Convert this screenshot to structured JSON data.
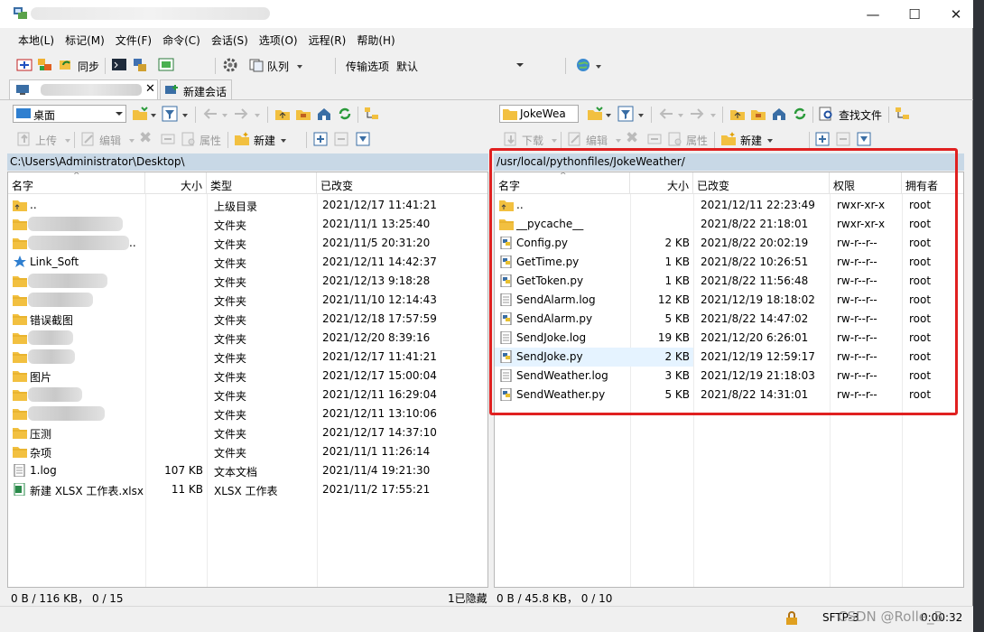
{
  "menu": [
    "本地(L)",
    "标记(M)",
    "文件(F)",
    "命令(C)",
    "会话(S)",
    "选项(O)",
    "远程(R)",
    "帮助(H)"
  ],
  "toolbar1": {
    "sync": "同步",
    "queue": "队列",
    "transfer_label": "传输选项",
    "transfer_value": "默认"
  },
  "tabs": {
    "new_session": "新建会话"
  },
  "left": {
    "location": "桌面",
    "upload": "上传",
    "edit": "编辑",
    "properties": "属性",
    "new": "新建",
    "path": "C:\\Users\\Administrator\\Desktop\\",
    "columns": [
      "名字",
      "大小",
      "类型",
      "已改变"
    ],
    "rows": [
      {
        "name": "..",
        "size": "",
        "type": "上级目录",
        "changed": "2021/12/17  11:41:21",
        "icon": "up"
      },
      {
        "name": "",
        "size": "",
        "type": "文件夹",
        "changed": "2021/11/1  13:25:40",
        "icon": "folder"
      },
      {
        "name": "..",
        "size": "",
        "type": "文件夹",
        "changed": "2021/11/5  20:31:20",
        "icon": "folder"
      },
      {
        "name": "Link_Soft",
        "size": "",
        "type": "文件夹",
        "changed": "2021/12/11  14:42:37",
        "icon": "star"
      },
      {
        "name": "",
        "size": "",
        "type": "文件夹",
        "changed": "2021/12/13  9:18:28",
        "icon": "folder"
      },
      {
        "name": "",
        "size": "",
        "type": "文件夹",
        "changed": "2021/11/10  12:14:43",
        "icon": "folder"
      },
      {
        "name": "错误截图",
        "size": "",
        "type": "文件夹",
        "changed": "2021/12/18  17:57:59",
        "icon": "folder"
      },
      {
        "name": "",
        "size": "",
        "type": "文件夹",
        "changed": "2021/12/20  8:39:16",
        "icon": "folder"
      },
      {
        "name": "",
        "size": "",
        "type": "文件夹",
        "changed": "2021/12/17  11:41:21",
        "icon": "folder"
      },
      {
        "name": "图片",
        "size": "",
        "type": "文件夹",
        "changed": "2021/12/17  15:00:04",
        "icon": "folder"
      },
      {
        "name": "",
        "size": "",
        "type": "文件夹",
        "changed": "2021/12/11  16:29:04",
        "icon": "folder"
      },
      {
        "name": "",
        "size": "",
        "type": "文件夹",
        "changed": "2021/12/11  13:10:06",
        "icon": "folder"
      },
      {
        "name": "压测",
        "size": "",
        "type": "文件夹",
        "changed": "2021/12/17  14:37:10",
        "icon": "folder"
      },
      {
        "name": "杂项",
        "size": "",
        "type": "文件夹",
        "changed": "2021/11/1  11:26:14",
        "icon": "folder"
      },
      {
        "name": "1.log",
        "size": "107 KB",
        "type": "文本文档",
        "changed": "2021/11/4  19:21:30",
        "icon": "doc"
      },
      {
        "name": "新建 XLSX 工作表.xlsx",
        "size": "11 KB",
        "type": "XLSX 工作表",
        "changed": "2021/11/2  17:55:21",
        "icon": "xlsx"
      }
    ],
    "status": "0 B / 116 KB， 0 / 15",
    "hidden": "1已隐藏"
  },
  "right": {
    "location": "JokeWea",
    "download": "下载",
    "edit": "编辑",
    "properties": "属性",
    "new": "新建",
    "find": "查找文件",
    "path": "/usr/local/pythonfiles/JokeWeather/",
    "columns": [
      "名字",
      "大小",
      "已改变",
      "权限",
      "拥有者"
    ],
    "rows": [
      {
        "name": "..",
        "size": "",
        "changed": "2021/12/11 22:23:49",
        "perm": "rwxr-xr-x",
        "owner": "root",
        "icon": "up"
      },
      {
        "name": "__pycache__",
        "size": "",
        "changed": "2021/8/22 21:18:01",
        "perm": "rwxr-xr-x",
        "owner": "root",
        "icon": "folder"
      },
      {
        "name": "Config.py",
        "size": "2 KB",
        "changed": "2021/8/22 20:02:19",
        "perm": "rw-r--r--",
        "owner": "root",
        "icon": "py"
      },
      {
        "name": "GetTime.py",
        "size": "1 KB",
        "changed": "2021/8/22 10:26:51",
        "perm": "rw-r--r--",
        "owner": "root",
        "icon": "py"
      },
      {
        "name": "GetToken.py",
        "size": "1 KB",
        "changed": "2021/8/22 11:56:48",
        "perm": "rw-r--r--",
        "owner": "root",
        "icon": "py"
      },
      {
        "name": "SendAlarm.log",
        "size": "12 KB",
        "changed": "2021/12/19 18:18:02",
        "perm": "rw-r--r--",
        "owner": "root",
        "icon": "doc"
      },
      {
        "name": "SendAlarm.py",
        "size": "5 KB",
        "changed": "2021/8/22 14:47:02",
        "perm": "rw-r--r--",
        "owner": "root",
        "icon": "py"
      },
      {
        "name": "SendJoke.log",
        "size": "19 KB",
        "changed": "2021/12/20 6:26:01",
        "perm": "rw-r--r--",
        "owner": "root",
        "icon": "doc"
      },
      {
        "name": "SendJoke.py",
        "size": "2 KB",
        "changed": "2021/12/19 12:59:17",
        "perm": "rw-r--r--",
        "owner": "root",
        "icon": "py"
      },
      {
        "name": "SendWeather.log",
        "size": "3 KB",
        "changed": "2021/12/19 21:18:03",
        "perm": "rw-r--r--",
        "owner": "root",
        "icon": "doc"
      },
      {
        "name": "SendWeather.py",
        "size": "5 KB",
        "changed": "2021/8/22 14:31:01",
        "perm": "rw-r--r--",
        "owner": "root",
        "icon": "py"
      }
    ],
    "status": "0 B / 45.8 KB， 0 / 10"
  },
  "bottom": {
    "protocol": "SFTP-3",
    "time": "0:00:32",
    "watermark": "CSDN @Rolle_B"
  },
  "colors": {
    "path_bg": "#c8d8e6",
    "highlight": "#e02020",
    "selected_row": "#e5f3ff"
  }
}
